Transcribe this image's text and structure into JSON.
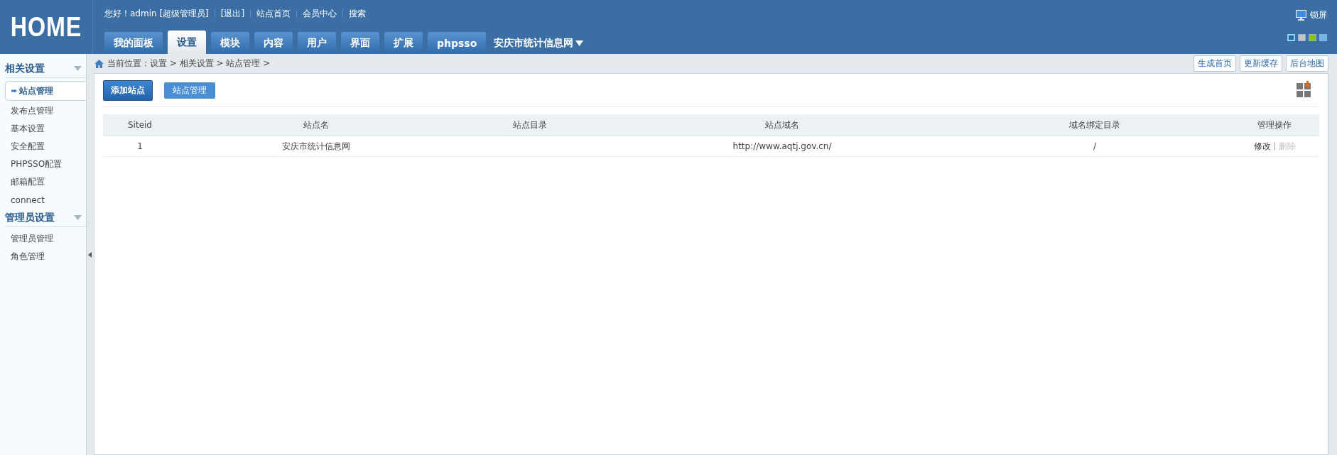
{
  "header": {
    "logo": "HOME",
    "top_links": [
      "您好！admin [超级管理员]",
      "[退出]",
      "站点首页",
      "会员中心",
      "搜索"
    ],
    "lock_screen": "锁屏",
    "tabs": [
      {
        "label": "我的面板",
        "selected": false
      },
      {
        "label": "设置",
        "selected": true
      },
      {
        "label": "模块",
        "selected": false
      },
      {
        "label": "内容",
        "selected": false
      },
      {
        "label": "用户",
        "selected": false
      },
      {
        "label": "界面",
        "selected": false
      },
      {
        "label": "扩展",
        "selected": false
      },
      {
        "label": "phpsso",
        "selected": false
      }
    ],
    "site_menu": "安庆市统计信息网",
    "theme_swatches": [
      {
        "color": "#1f6fa8",
        "selected": true
      },
      {
        "color": "#c4c4c4",
        "selected": false
      },
      {
        "color": "#8cc414",
        "selected": false
      },
      {
        "color": "#6ab8ea",
        "selected": false
      }
    ]
  },
  "sidebar": [
    {
      "title": "相关设置",
      "expanded": true,
      "items": [
        {
          "label": "站点管理",
          "selected": true
        },
        {
          "label": "发布点管理",
          "selected": false
        },
        {
          "label": "基本设置",
          "selected": false
        },
        {
          "label": "安全配置",
          "selected": false
        },
        {
          "label": "PHPSSO配置",
          "selected": false
        },
        {
          "label": "邮箱配置",
          "selected": false
        },
        {
          "label": "connect",
          "selected": false
        }
      ]
    },
    {
      "title": "管理员设置",
      "expanded": true,
      "items": [
        {
          "label": "管理员管理",
          "selected": false
        },
        {
          "label": "角色管理",
          "selected": false
        }
      ]
    }
  ],
  "breadcrumb": "当前位置：设置 > 相关设置 > 站点管理 >",
  "quick_buttons": [
    "生成首页",
    "更新缓存",
    "后台地图"
  ],
  "subtabs": [
    {
      "label": "添加站点",
      "selected": true
    },
    {
      "label": "站点管理",
      "selected": false
    }
  ],
  "table": {
    "columns": [
      "Siteid",
      "站点名",
      "站点目录",
      "站点域名",
      "域名绑定目录",
      "管理操作"
    ],
    "rows": [
      {
        "cells": [
          "1",
          "安庆市统计信息网",
          "",
          "http://www.aqtj.gov.cn/",
          "/"
        ],
        "actions": [
          {
            "label": "修改",
            "disabled": false
          },
          {
            "label": "删除",
            "disabled": true
          }
        ]
      }
    ]
  }
}
